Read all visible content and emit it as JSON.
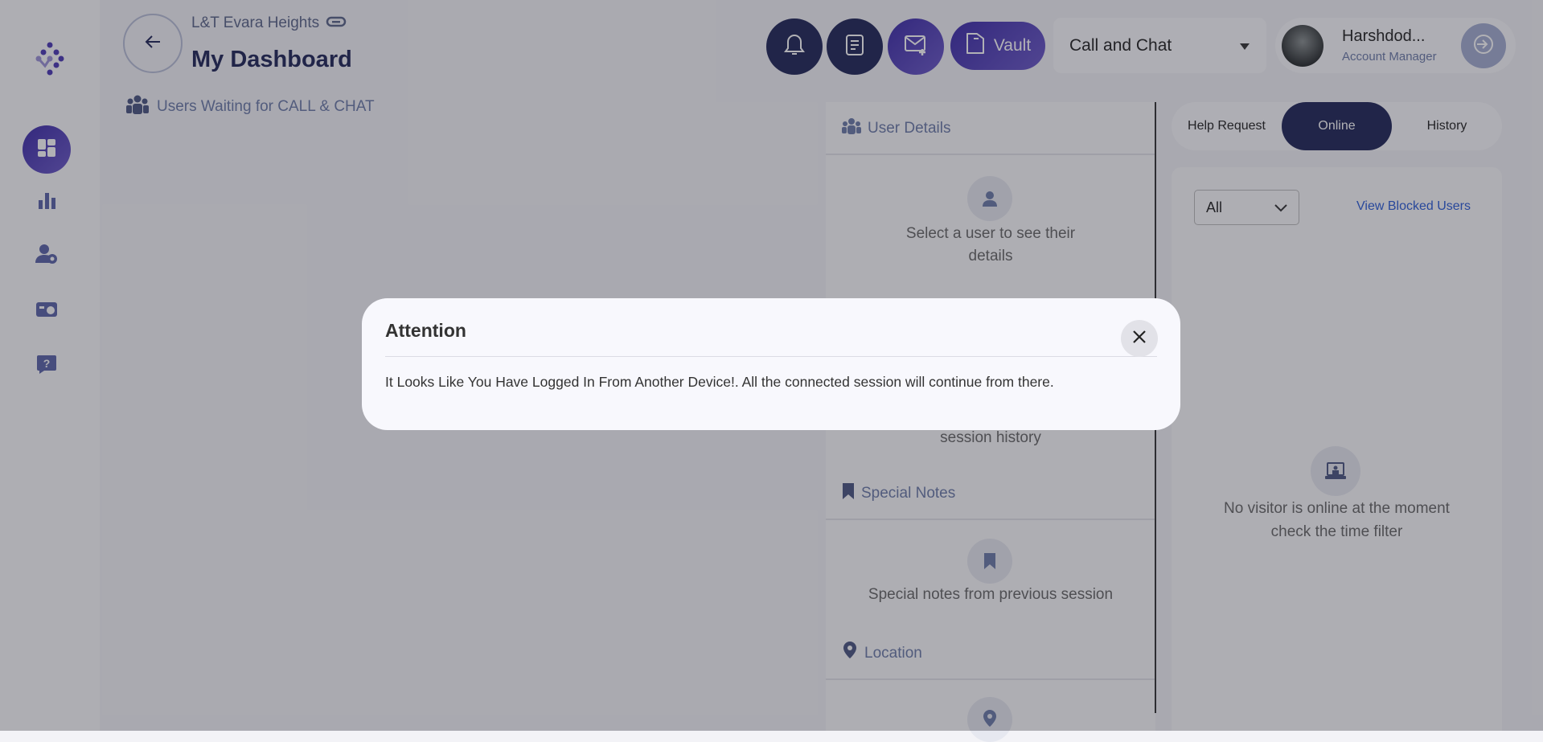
{
  "header": {
    "project": "L&T Evara Heights",
    "title": "My Dashboard",
    "waiting_label": "Users Waiting for  CALL & CHAT"
  },
  "toolbar": {
    "vault_label": "Vault",
    "mode_select": "Call and Chat"
  },
  "profile": {
    "name": "Harshdod...",
    "role": "Account Manager"
  },
  "user_details": {
    "heading": "User Details",
    "empty_text": "Select a user to see their details",
    "history_text": "session history"
  },
  "special_notes": {
    "heading": "Special Notes",
    "empty_text": "Special notes from previous session"
  },
  "location": {
    "heading": "Location"
  },
  "tabs": [
    {
      "label": "Help Request"
    },
    {
      "label": "Online",
      "active": true
    },
    {
      "label": "History"
    }
  ],
  "online": {
    "filter": "All",
    "blocked_link": "View Blocked Users",
    "empty_line1": "No visitor is online at the moment",
    "empty_line2": "check the time filter"
  },
  "modal": {
    "title": "Attention",
    "message": "It Looks Like You Have Logged In From Another Device!. All the connected session will continue from there."
  },
  "colors": {
    "primary": "#1f2456",
    "accent": "#4a37b5",
    "link": "#2a5bd7"
  }
}
